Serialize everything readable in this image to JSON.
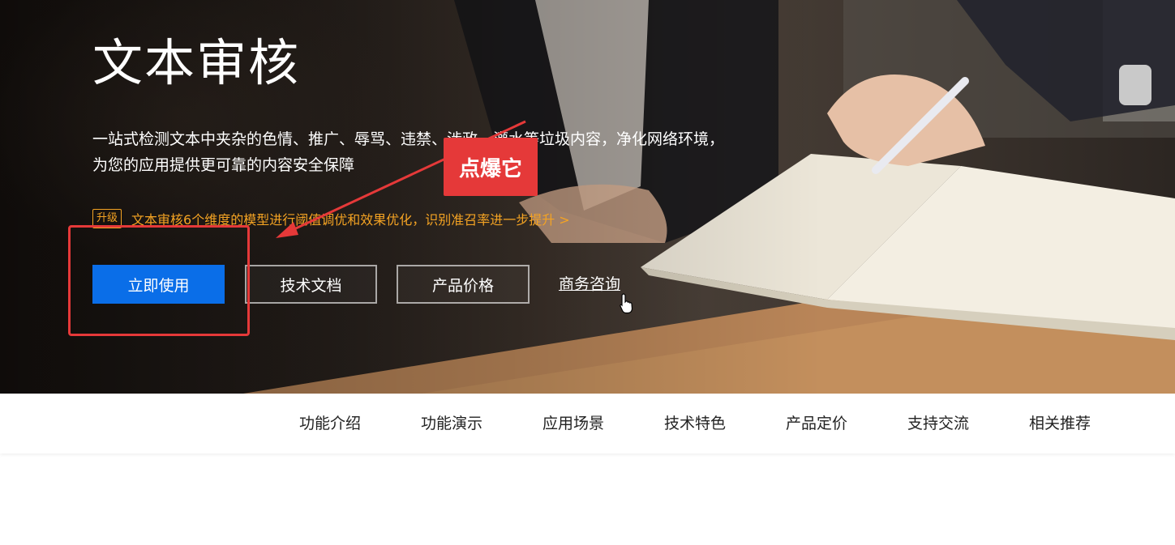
{
  "hero": {
    "title": "文本审核",
    "description": "一站式检测文本中夹杂的色情、推广、辱骂、违禁、涉政、灌水等垃圾内容，净化网络环境，为您的应用提供更可靠的内容安全保障",
    "upgrade_badge": "升级",
    "upgrade_text": "文本审核6个维度的模型进行阈值调优和效果优化，识别准召率进一步提升 >",
    "buttons": {
      "primary": "立即使用",
      "docs": "技术文档",
      "price": "产品价格",
      "business": "商务咨询"
    }
  },
  "annotation": {
    "label": "点爆它"
  },
  "subnav": {
    "items": [
      "功能介绍",
      "功能演示",
      "应用场景",
      "技术特色",
      "产品定价",
      "支持交流",
      "相关推荐"
    ]
  },
  "colors": {
    "primary": "#0a6ee8",
    "accent": "#f4a323",
    "annotation": "#e53939"
  },
  "icons": {
    "cursor": "hand-pointer-icon"
  }
}
